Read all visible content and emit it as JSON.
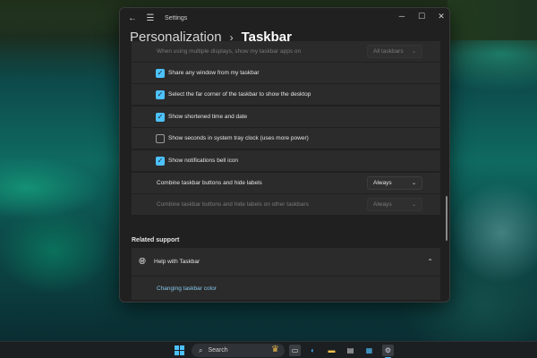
{
  "window": {
    "title": "Settings",
    "breadcrumb_parent": "Personalization",
    "breadcrumb_sep": "›",
    "breadcrumb_current": "Taskbar"
  },
  "settings": {
    "multi_display_label": "When using multiple displays, show my taskbar apps on",
    "multi_display_value": "All taskbars",
    "checkboxes": [
      {
        "label": "Share any window from my taskbar",
        "checked": true
      },
      {
        "label": "Select the far corner of the taskbar to show the desktop",
        "checked": true
      },
      {
        "label": "Show shortened time and date",
        "checked": true
      },
      {
        "label": "Show seconds in system tray clock (uses more power)",
        "checked": false
      },
      {
        "label": "Show notifications bell icon",
        "checked": true
      }
    ],
    "combine_label": "Combine taskbar buttons and hide labels",
    "combine_value": "Always",
    "combine_other_label": "Combine taskbar buttons and hide labels on other taskbars",
    "combine_other_value": "Always"
  },
  "related": {
    "section_title": "Related support",
    "help_label": "Help with Taskbar",
    "link_label": "Changing taskbar color"
  },
  "taskbar": {
    "search_placeholder": "Search",
    "apps": [
      "task-view-icon",
      "edge-icon",
      "file-explorer-icon",
      "notepad-icon",
      "store-icon",
      "settings-icon"
    ]
  },
  "colors": {
    "accent": "#4cc2ff",
    "window_bg": "#202020",
    "card_bg": "#2b2b2b",
    "link": "#86c8ec"
  }
}
